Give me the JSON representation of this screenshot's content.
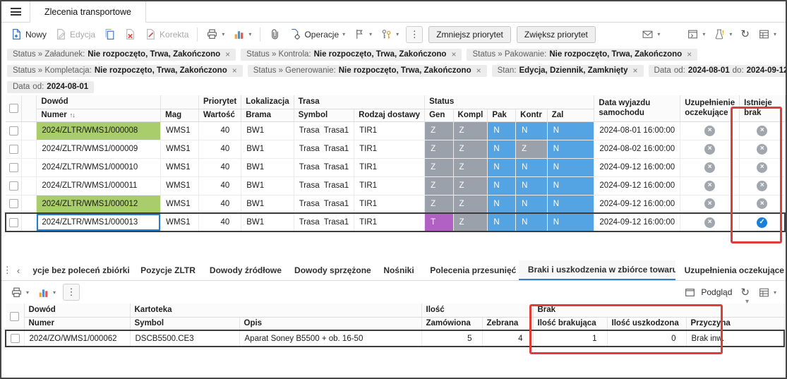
{
  "icons": {
    "close": "×",
    "chevron_down": "▾",
    "more": "⋮",
    "sort": "↑↓",
    "refresh": "↻",
    "scroll_left": "‹",
    "collapse": "▾"
  },
  "status_colors": {
    "Z": "#9aa1ab",
    "N": "#54a3e2",
    "T": "#b160c4"
  },
  "colors": {
    "row_highlight_green": "#a8cd6a",
    "selected_cell_blue": "#1f7fd4",
    "annotation_red": "#e03c3c",
    "active_tab_blue": "#2e7ec7",
    "check_blue": "#1c7fd6",
    "icon_circle_gray": "#a2a7ad"
  },
  "window": {
    "tab_title": "Zlecenia transportowe"
  },
  "toolbar": {
    "nowy": "Nowy",
    "edycja": "Edycja",
    "korekta": "Korekta",
    "operacje": "Operacje",
    "zmniejsz_priorytet": "Zmniejsz priorytet",
    "zwieksz_priorytet": "Zwiększ priorytet"
  },
  "filters": {
    "chips": [
      {
        "label": "Status » Załadunek:",
        "value": "Nie rozpoczęto, Trwa, Zakończono"
      },
      {
        "label": "Status » Kontrola:",
        "value": "Nie rozpoczęto, Trwa, Zakończono"
      },
      {
        "label": "Status » Pakowanie:",
        "value": "Nie rozpoczęto, Trwa, Zakończono"
      },
      {
        "label": "Status » Kompletacja:",
        "value": "Nie rozpoczęto, Trwa, Zakończono"
      },
      {
        "label": "Status » Generowanie:",
        "value": "Nie rozpoczęto, Trwa, Zakończono"
      },
      {
        "label": "Stan:",
        "value": "Edycja, Dziennik, Zamknięty"
      },
      {
        "label": "Data",
        "od_label": "od:",
        "od": "2024-08-01",
        "do_label": "do:",
        "do": "2024-09-12"
      },
      {
        "label": "Data",
        "od_label": "od:",
        "od": "2024-08-01"
      }
    ]
  },
  "main_table": {
    "groups": {
      "dowod": "Dowód",
      "priorytet": "Priorytet",
      "lokalizacja": "Lokalizacja",
      "trasa": "Trasa",
      "status": "Status"
    },
    "columns": {
      "numer": "Numer",
      "mag": "Mag",
      "wartosc": "Wartość",
      "brama": "Brama",
      "symbol": "Symbol",
      "rodzaj_dostawy": "Rodzaj dostawy",
      "gen": "Gen",
      "kompl": "Kompl",
      "pak": "Pak",
      "kontr": "Kontr",
      "zal": "Zal",
      "data_wyjazdu_line1": "Data wyjazdu",
      "data_wyjazdu_line2": "samochodu",
      "uzupelnienie_line1": "Uzupełnienie",
      "uzupelnienie_line2": "oczekujące",
      "istnieje_line1": "Istnieje",
      "istnieje_line2": "brak"
    },
    "rows": [
      {
        "numer": "2024/ZLTR/WMS1/000008",
        "mag": "WMS1",
        "wartosc": "40",
        "brama": "BW1",
        "trasa_symbol": "Trasa  Trasa1",
        "rodzaj_dostawy": "TIR1",
        "gen": "Z",
        "kompl": "Z",
        "pak": "N",
        "kontr": "N",
        "zal": "N",
        "data_wyjazdu": "2024-08-01 16:00:00",
        "numer_class": "hl-green",
        "uzupelnienie_icon": "ic-x",
        "istnieje_brak_icon": "ic-x"
      },
      {
        "numer": "2024/ZLTR/WMS1/000009",
        "mag": "WMS1",
        "wartosc": "40",
        "brama": "BW1",
        "trasa_symbol": "Trasa  Trasa1",
        "rodzaj_dostawy": "TIR1",
        "gen": "Z",
        "kompl": "Z",
        "pak": "N",
        "kontr": "Z",
        "zal": "N",
        "data_wyjazdu": "2024-08-02 16:00:00",
        "uzupelnienie_icon": "ic-x",
        "istnieje_brak_icon": "ic-x"
      },
      {
        "numer": "2024/ZLTR/WMS1/000010",
        "mag": "WMS1",
        "wartosc": "40",
        "brama": "BW1",
        "trasa_symbol": "Trasa  Trasa1",
        "rodzaj_dostawy": "TIR1",
        "gen": "Z",
        "kompl": "Z",
        "pak": "N",
        "kontr": "N",
        "zal": "N",
        "data_wyjazdu": "2024-09-12 16:00:00",
        "uzupelnienie_icon": "ic-x",
        "istnieje_brak_icon": "ic-x"
      },
      {
        "numer": "2024/ZLTR/WMS1/000011",
        "mag": "WMS1",
        "wartosc": "40",
        "brama": "BW1",
        "trasa_symbol": "Trasa  Trasa1",
        "rodzaj_dostawy": "TIR1",
        "gen": "Z",
        "kompl": "Z",
        "pak": "N",
        "kontr": "N",
        "zal": "N",
        "data_wyjazdu": "2024-09-12 16:00:00",
        "uzupelnienie_icon": "ic-x",
        "istnieje_brak_icon": "ic-x"
      },
      {
        "numer": "2024/ZLTR/WMS1/000012",
        "mag": "WMS1",
        "wartosc": "40",
        "brama": "BW1",
        "trasa_symbol": "Trasa  Trasa1",
        "rodzaj_dostawy": "TIR1",
        "gen": "Z",
        "kompl": "Z",
        "pak": "N",
        "kontr": "N",
        "zal": "N",
        "data_wyjazdu": "2024-09-12 16:00:00",
        "numer_class": "hl-green",
        "uzupelnienie_icon": "ic-x",
        "istnieje_brak_icon": "ic-x"
      },
      {
        "numer": "2024/ZLTR/WMS1/000013",
        "mag": "WMS1",
        "wartosc": "40",
        "brama": "BW1",
        "trasa_symbol": "Trasa  Trasa1",
        "rodzaj_dostawy": "TIR1",
        "gen": "T",
        "kompl": "Z",
        "pak": "N",
        "kontr": "N",
        "zal": "N",
        "data_wyjazdu": "2024-09-12 16:00:00",
        "uzupelnienie_icon": "ic-x",
        "istnieje_brak_icon": "ic-check"
      }
    ]
  },
  "bottom_panel": {
    "tabs": [
      {
        "label": "ycje bez poleceń zbiórki"
      },
      {
        "label": "Pozycje ZLTR"
      },
      {
        "label": "Dowody źródłowe"
      },
      {
        "label": "Dowody sprzężone"
      },
      {
        "label": "Nośniki"
      },
      {
        "label": "Polecenia przesunięć"
      },
      {
        "label": "Braki i uszkodzenia w zbiórce towaru"
      },
      {
        "label": "Uzupełnienia oczekujące"
      }
    ],
    "active_tab": "Braki i uszkodzenia w zbiórce towaru",
    "toolbar": {
      "podglad": "Podgląd"
    },
    "table": {
      "groups": {
        "dowod": "Dowód",
        "kartoteka": "Kartoteka",
        "ilosc": "Ilość",
        "brak": "Brak"
      },
      "columns": {
        "numer": "Numer",
        "symbol": "Symbol",
        "opis": "Opis",
        "zamowiona": "Zamówiona",
        "zebrana": "Zebrana",
        "ilosc_brakujaca": "Ilość brakująca",
        "ilosc_uszkodzona": "Ilość uszkodzona",
        "przyczyna": "Przyczyna"
      },
      "rows": [
        {
          "numer": "2024/ZO/WMS1/000062",
          "symbol": "DSCB5500.CE3",
          "opis": "Aparat Soney B5500 + ob. 16-50",
          "zamowiona": "5",
          "zebrana": "4",
          "ilosc_brakujaca": "1",
          "ilosc_uszkodzona": "0",
          "przyczyna": "Brak inw."
        }
      ]
    }
  }
}
